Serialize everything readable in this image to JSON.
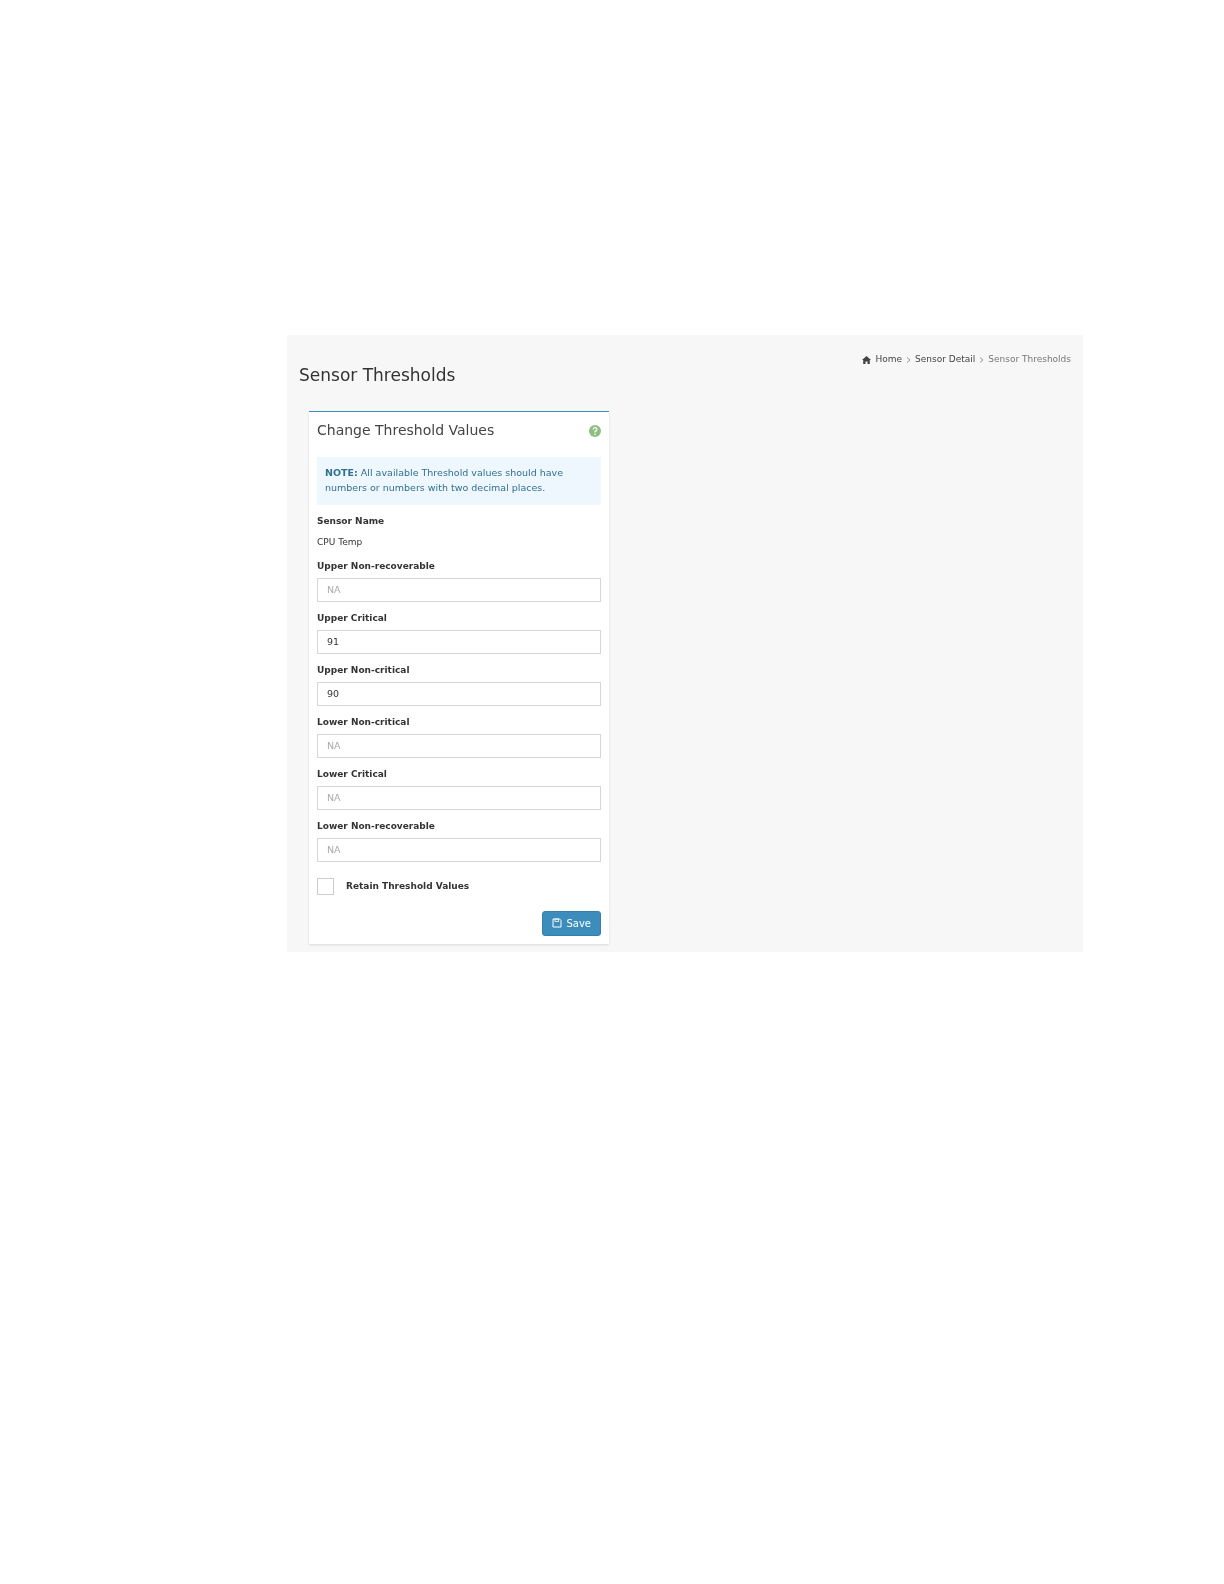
{
  "page": {
    "title": "Sensor Thresholds"
  },
  "breadcrumb": [
    {
      "label": "Home",
      "kind": "home"
    },
    {
      "label": "Sensor Detail",
      "kind": "link"
    },
    {
      "label": "Sensor Thresholds",
      "kind": "current"
    }
  ],
  "card": {
    "title": "Change Threshold Values",
    "note": "**NOTE:** All available Threshold values should have numbers or numbers with two decimal places.",
    "sensor_name_label": "Sensor Name",
    "sensor_name": "CPU Temp",
    "fields": [
      {
        "label": "Upper Non-recoverable",
        "placeholder": "NA"
      },
      {
        "label": "Upper Critical",
        "value": "91"
      },
      {
        "label": "Upper Non-critical",
        "value": "90"
      },
      {
        "label": "Lower Non-critical",
        "placeholder": "NA"
      },
      {
        "label": "Lower Critical",
        "placeholder": "NA"
      },
      {
        "label": "Lower Non-recoverable",
        "placeholder": "NA"
      }
    ],
    "retain": {
      "label": "Retain Threshold Values",
      "checked": false
    },
    "save_button": "Save"
  }
}
